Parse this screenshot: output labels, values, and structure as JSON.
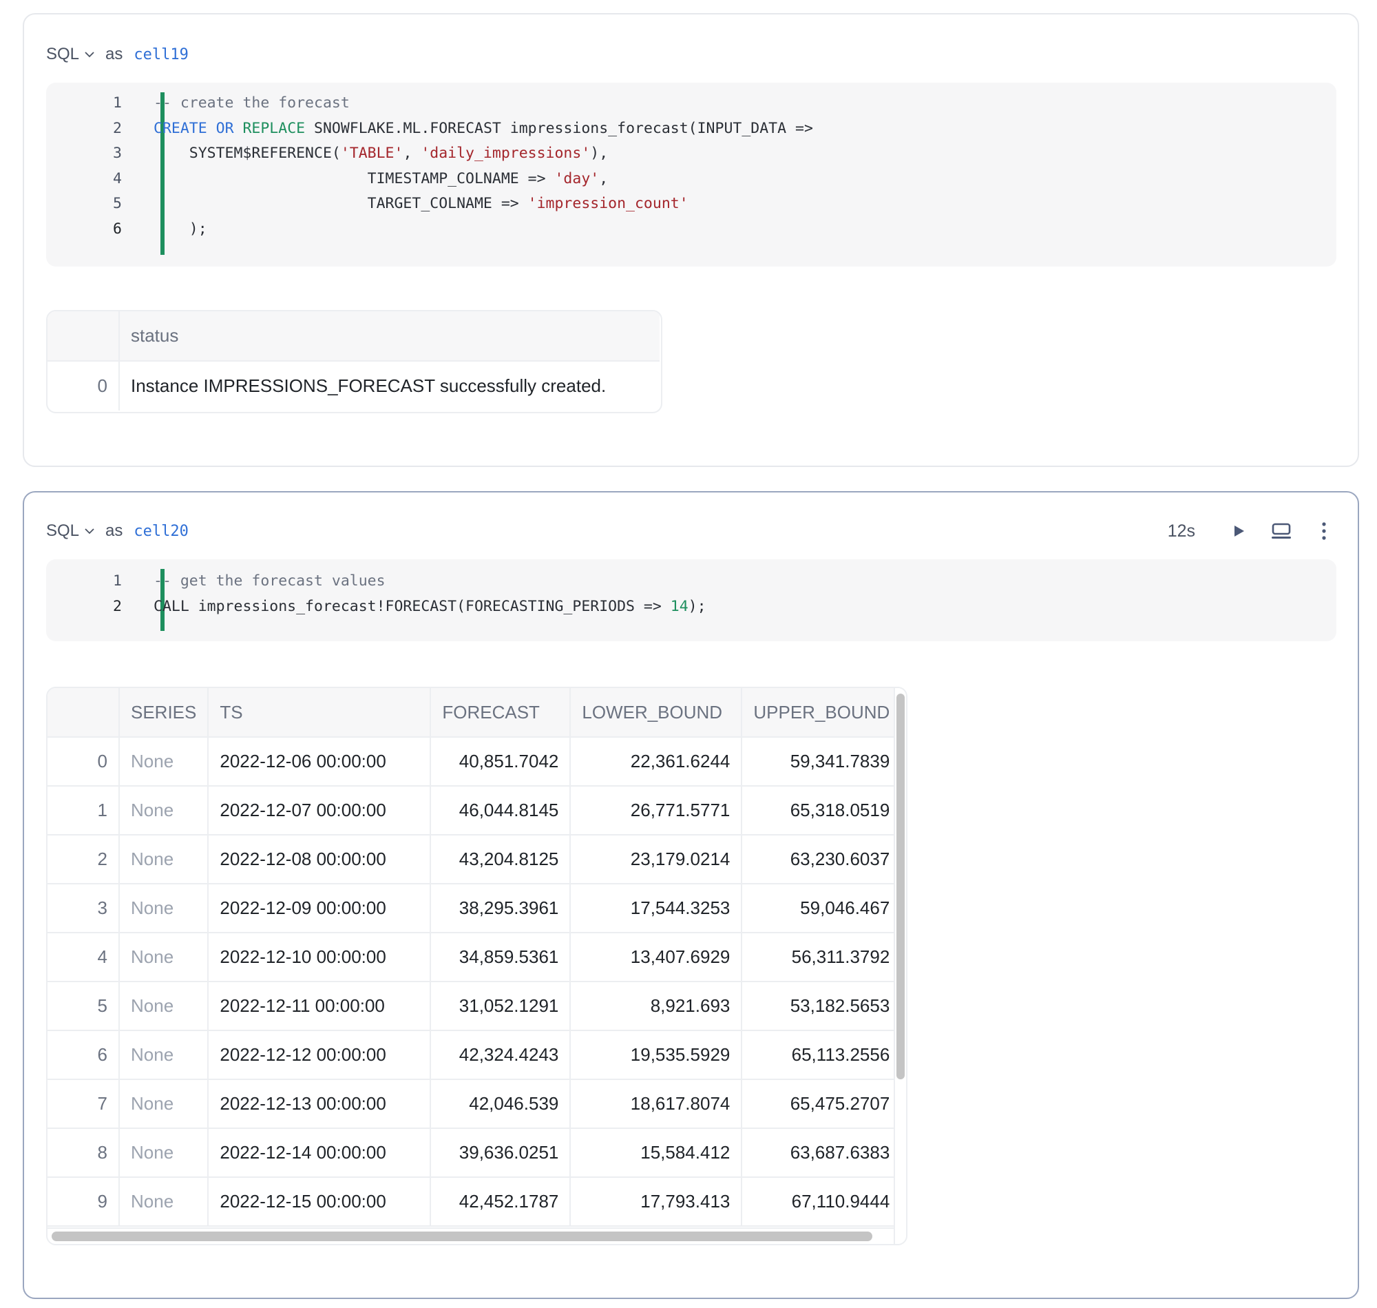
{
  "cells": [
    {
      "language": "SQL",
      "as_label": "as",
      "name": "cell19",
      "code_lines": [
        {
          "n": "1",
          "tokens": [
            {
              "t": "-- create the forecast",
              "c": "comment"
            }
          ]
        },
        {
          "n": "2",
          "tokens": [
            {
              "t": "CREATE",
              "c": "kw-blue"
            },
            {
              "t": " ",
              "c": ""
            },
            {
              "t": "OR",
              "c": "kw-blue"
            },
            {
              "t": " ",
              "c": ""
            },
            {
              "t": "REPLACE",
              "c": "kw-green"
            },
            {
              "t": " SNOWFLAKE.ML.FORECAST impressions_forecast(INPUT_DATA =>",
              "c": ""
            }
          ]
        },
        {
          "n": "3",
          "tokens": [
            {
              "t": "    SYSTEM$REFERENCE(",
              "c": ""
            },
            {
              "t": "'TABLE'",
              "c": "str"
            },
            {
              "t": ", ",
              "c": ""
            },
            {
              "t": "'daily_impressions'",
              "c": "str"
            },
            {
              "t": "),",
              "c": ""
            }
          ]
        },
        {
          "n": "4",
          "tokens": [
            {
              "t": "                        TIMESTAMP_COLNAME => ",
              "c": ""
            },
            {
              "t": "'day'",
              "c": "str"
            },
            {
              "t": ",",
              "c": ""
            }
          ]
        },
        {
          "n": "5",
          "tokens": [
            {
              "t": "                        TARGET_COLNAME => ",
              "c": ""
            },
            {
              "t": "'impression_count'",
              "c": "str"
            }
          ]
        },
        {
          "n": "6",
          "tokens": [
            {
              "t": "    );",
              "c": ""
            }
          ],
          "active": true
        }
      ],
      "result": {
        "columns": [
          "",
          "status"
        ],
        "rows": [
          [
            "0",
            "Instance IMPRESSIONS_FORECAST successfully created."
          ]
        ]
      }
    },
    {
      "language": "SQL",
      "as_label": "as",
      "name": "cell20",
      "selected": true,
      "toolbar": {
        "duration": "12s",
        "run_icon": "play-icon",
        "output_icon": "monitor-icon",
        "more_icon": "kebab-menu-icon"
      },
      "code_lines": [
        {
          "n": "1",
          "tokens": [
            {
              "t": "-- get the forecast values",
              "c": "comment"
            }
          ]
        },
        {
          "n": "2",
          "tokens": [
            {
              "t": "CALL impressions_forecast!FORECAST(FORECASTING_PERIODS => ",
              "c": ""
            },
            {
              "t": "14",
              "c": "num"
            },
            {
              "t": ");",
              "c": ""
            }
          ],
          "active": true
        }
      ],
      "result": {
        "columns": [
          "",
          "SERIES",
          "TS",
          "FORECAST",
          "LOWER_BOUND",
          "UPPER_BOUND"
        ],
        "rows": [
          [
            "0",
            "None",
            "2022-12-06 00:00:00",
            "40,851.7042",
            "22,361.6244",
            "59,341.7839"
          ],
          [
            "1",
            "None",
            "2022-12-07 00:00:00",
            "46,044.8145",
            "26,771.5771",
            "65,318.0519"
          ],
          [
            "2",
            "None",
            "2022-12-08 00:00:00",
            "43,204.8125",
            "23,179.0214",
            "63,230.6037"
          ],
          [
            "3",
            "None",
            "2022-12-09 00:00:00",
            "38,295.3961",
            "17,544.3253",
            "59,046.467"
          ],
          [
            "4",
            "None",
            "2022-12-10 00:00:00",
            "34,859.5361",
            "13,407.6929",
            "56,311.3792"
          ],
          [
            "5",
            "None",
            "2022-12-11 00:00:00",
            "31,052.1291",
            "8,921.693",
            "53,182.5653"
          ],
          [
            "6",
            "None",
            "2022-12-12 00:00:00",
            "42,324.4243",
            "19,535.5929",
            "65,113.2556"
          ],
          [
            "7",
            "None",
            "2022-12-13 00:00:00",
            "42,046.539",
            "18,617.8074",
            "65,475.2707"
          ],
          [
            "8",
            "None",
            "2022-12-14 00:00:00",
            "39,636.0251",
            "15,584.412",
            "63,687.6383"
          ],
          [
            "9",
            "None",
            "2022-12-15 00:00:00",
            "42,452.1787",
            "17,793.413",
            "67,110.9444"
          ]
        ]
      }
    }
  ],
  "colors": {
    "accent_green": "#1e8f5e",
    "keyword_blue": "#2f6fd6",
    "string_red": "#a4262c",
    "selected_border": "#9aa6bf"
  }
}
